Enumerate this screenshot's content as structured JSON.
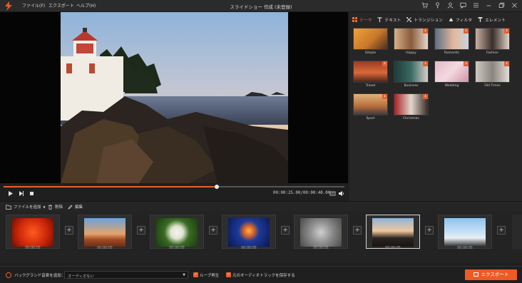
{
  "app": {
    "title": "スライドショー 作成 (未登録)",
    "menu": [
      "ファイル(F)",
      "エクスポート",
      "ヘルプ(H)"
    ],
    "window_icons": [
      "cart-icon",
      "key-icon",
      "user-icon",
      "feedback-icon",
      "menu-icon",
      "minimize-icon",
      "restore-icon",
      "close-icon"
    ]
  },
  "player": {
    "progress_percent": 62.5,
    "timecode": "00:00:25.00/00:00:40.00"
  },
  "panel": {
    "tabs": [
      {
        "label": "テーマ",
        "icon": "theme-icon",
        "active": true
      },
      {
        "label": "テキスト",
        "icon": "text-icon",
        "active": false
      },
      {
        "label": "トランジション",
        "icon": "transition-icon",
        "active": false
      },
      {
        "label": "フィルタ",
        "icon": "filter-icon",
        "active": false
      },
      {
        "label": "エレメント",
        "icon": "element-icon",
        "active": false
      }
    ],
    "themes": [
      {
        "name": "Simple",
        "download": false
      },
      {
        "name": "Happy",
        "download": true
      },
      {
        "name": "Romantic",
        "download": true
      },
      {
        "name": "Fashion",
        "download": true
      },
      {
        "name": "Travel",
        "download": true
      },
      {
        "name": "Business",
        "download": true
      },
      {
        "name": "Wedding",
        "download": true
      },
      {
        "name": "Old Times",
        "download": true
      },
      {
        "name": "Sport",
        "download": true
      },
      {
        "name": "Christmas",
        "download": true
      }
    ]
  },
  "toolbar": {
    "add_file": "ファイルを追加",
    "delete": "削除",
    "edit": "編集"
  },
  "timeline": {
    "clips": [
      {
        "subject": "red-flower",
        "duration": "00:00:05"
      },
      {
        "subject": "desert-canyon",
        "duration": "00:00:05"
      },
      {
        "subject": "white-flower",
        "duration": "00:00:05"
      },
      {
        "subject": "jellyfish",
        "duration": "00:00:05"
      },
      {
        "subject": "koala",
        "duration": "00:00:05"
      },
      {
        "subject": "lighthouse",
        "duration": "00:00:05",
        "selected": true
      },
      {
        "subject": "penguins",
        "duration": "00:00:05"
      }
    ]
  },
  "bottom": {
    "bg_music_label": "バックグランド音楽を追加：",
    "audio_select": "オーディオない",
    "loop_label": "ループ再生",
    "keep_original_label": "元のオーディオトラックを保存する",
    "export_label": "エクスポート"
  },
  "colors": {
    "accent": "#ef5a24"
  }
}
